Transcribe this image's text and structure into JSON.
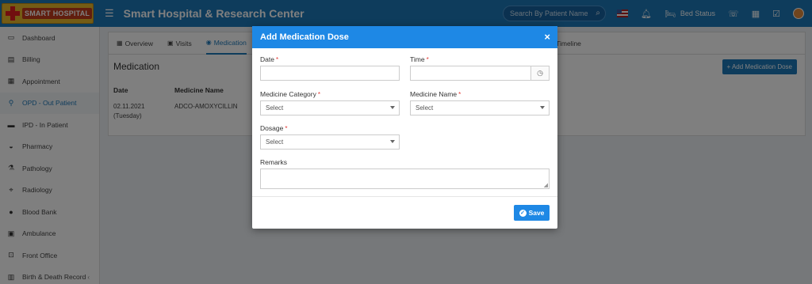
{
  "header": {
    "logo_text": "SMART HOSPITAL",
    "title": "Smart Hospital & Research Center",
    "search_placeholder": "Search By Patient Name",
    "bed_status": "Bed Status"
  },
  "sidebar": {
    "items": [
      {
        "label": "Dashboard",
        "icon": "monitor-icon"
      },
      {
        "label": "Billing",
        "icon": "file-icon"
      },
      {
        "label": "Appointment",
        "icon": "calendar-icon"
      },
      {
        "label": "OPD - Out Patient",
        "icon": "stethoscope-icon"
      },
      {
        "label": "IPD - In Patient",
        "icon": "bed-icon"
      },
      {
        "label": "Pharmacy",
        "icon": "mortar-icon"
      },
      {
        "label": "Pathology",
        "icon": "flask-icon"
      },
      {
        "label": "Radiology",
        "icon": "microscope-icon"
      },
      {
        "label": "Blood Bank",
        "icon": "drop-icon"
      },
      {
        "label": "Ambulance",
        "icon": "ambulance-icon"
      },
      {
        "label": "Front Office",
        "icon": "desk-icon"
      },
      {
        "label": "Birth & Death Record",
        "icon": "record-icon"
      }
    ]
  },
  "main": {
    "tabs": [
      {
        "label": "Overview"
      },
      {
        "label": "Visits"
      },
      {
        "label": "Medication"
      },
      {
        "label": "tion"
      },
      {
        "label": "Timeline"
      }
    ],
    "section_title": "Medication",
    "add_button": "+ Add Medication Dose",
    "table": {
      "headers": [
        "Date",
        "Medicine Name"
      ],
      "row": {
        "date_line1": "02.11.2021",
        "date_line2": "(Tuesday)",
        "medicine": "ADCO-AMOXYCILLIN"
      }
    }
  },
  "modal": {
    "title": "Add Medication Dose",
    "close": "×",
    "fields": {
      "date_label": "Date",
      "time_label": "Time",
      "category_label": "Medicine Category",
      "category_value": "Select",
      "name_label": "Medicine Name",
      "name_value": "Select",
      "dosage_label": "Dosage",
      "dosage_value": "Select",
      "remarks_label": "Remarks",
      "required_mark": "*"
    },
    "save_label": "Save"
  },
  "colors": {
    "topbar": "#1d78b9",
    "modal_header": "#1e88e5",
    "required": "#e53935"
  }
}
